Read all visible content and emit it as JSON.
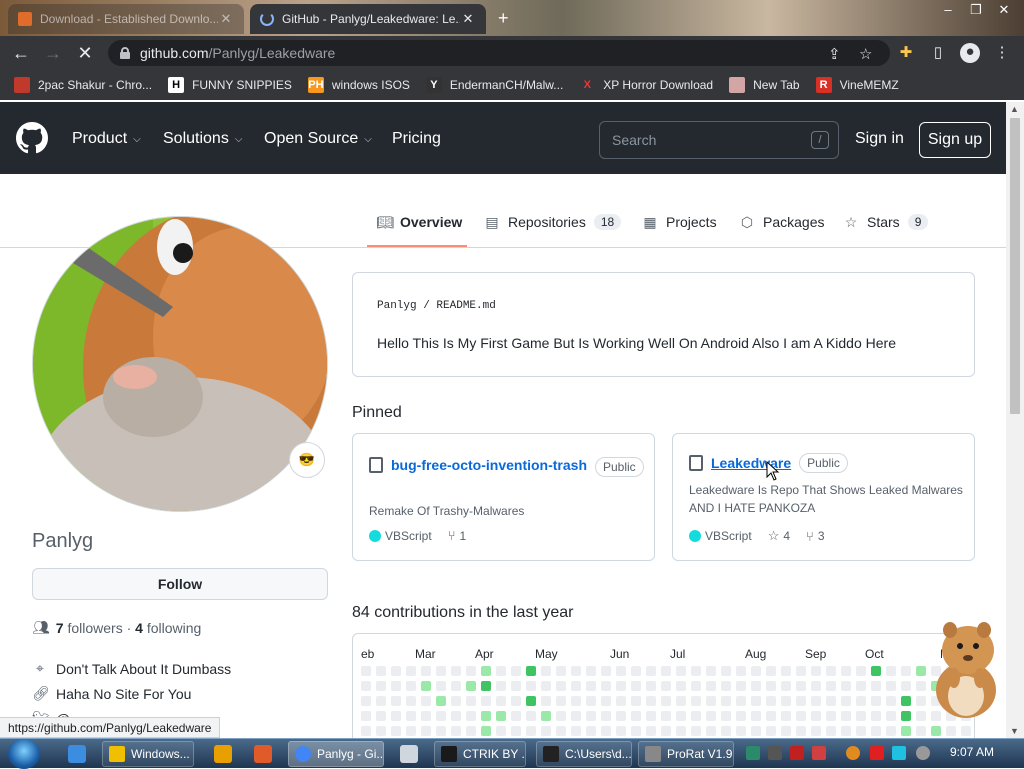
{
  "browser": {
    "tabs": [
      {
        "label": "Download - Established Downlo...",
        "active": false
      },
      {
        "label": "GitHub - Panlyg/Leakedware: Le...",
        "active": true
      }
    ],
    "new_tab": "+",
    "window_controls": {
      "minimize": "–",
      "maximize": "❐",
      "close": "✕"
    },
    "url_host": "github.com",
    "url_path": "/Panlyg/Leakedware",
    "bookmarks": [
      {
        "label": "2pac Shakur - Chro...",
        "icon": "2pac-icon",
        "icon_color": "#c0392b",
        "glyph": ""
      },
      {
        "label": "FUNNY SNIPPIES",
        "icon": "h-icon",
        "icon_color": "#ffffff",
        "glyph": "H"
      },
      {
        "label": "windows ISOS",
        "icon": "ph-icon",
        "icon_color": "#f7971d",
        "glyph": "PH"
      },
      {
        "label": "EndermanCH/Malw...",
        "icon": "yt-icon",
        "icon_color": "#333333",
        "glyph": "Y"
      },
      {
        "label": "XP Horror Download",
        "icon": "x-icon",
        "icon_color": "#35363a",
        "glyph": "X"
      },
      {
        "label": "New Tab",
        "icon": "globe-icon",
        "icon_color": "#d4a5a5",
        "glyph": ""
      },
      {
        "label": "VineMEMZ",
        "icon": "r-icon",
        "icon_color": "#d93025",
        "glyph": "R"
      }
    ]
  },
  "gh_header": {
    "nav": [
      {
        "label": "Product",
        "has_chevron": true
      },
      {
        "label": "Solutions",
        "has_chevron": true
      },
      {
        "label": "Open Source",
        "has_chevron": true
      },
      {
        "label": "Pricing",
        "has_chevron": false
      }
    ],
    "search_placeholder": "Search",
    "search_shortcut": "/",
    "sign_in": "Sign in",
    "sign_up": "Sign up"
  },
  "profile_tabs": [
    {
      "label": "Overview",
      "icon": "book-icon",
      "count": null,
      "selected": true
    },
    {
      "label": "Repositories",
      "icon": "repo-icon",
      "count": "18",
      "selected": false
    },
    {
      "label": "Projects",
      "icon": "table-icon",
      "count": null,
      "selected": false
    },
    {
      "label": "Packages",
      "icon": "package-icon",
      "count": null,
      "selected": false
    },
    {
      "label": "Stars",
      "icon": "star-icon",
      "count": "9",
      "selected": false
    }
  ],
  "profile": {
    "status_emoji": "😎",
    "username": "Panlyg",
    "follow_label": "Follow",
    "followers_count": "7",
    "followers_label": "followers",
    "separator": "·",
    "following_count": "4",
    "following_label": "following",
    "location": "Don't Talk About It Dumbass",
    "website": "Haha No Site For You",
    "twitter": "@..."
  },
  "readme": {
    "path": "Panlyg / README.md",
    "text": "Hello This Is My First Game But Is Working Well On Android Also I am A Kiddo Here"
  },
  "pinned": {
    "title": "Pinned",
    "repos": [
      {
        "name": "bug-free-octo-invention-trash",
        "visibility": "Public",
        "description": "Remake Of Trashy-Malwares",
        "language": "VBScript",
        "language_color": "#15dcdc",
        "stars": null,
        "forks": "1"
      },
      {
        "name": "Leakedware",
        "visibility": "Public",
        "description": "Leakedware Is Repo That Shows Leaked Malwares AND I HATE PANKOZA",
        "language": "VBScript",
        "language_color": "#15dcdc",
        "stars": "4",
        "forks": "3"
      }
    ]
  },
  "contributions": {
    "title": "84 contributions in the last year",
    "months": [
      "eb",
      "Mar",
      "Apr",
      "May",
      "Jun",
      "Jul",
      "Aug",
      "Sep",
      "Oct",
      "N"
    ],
    "colors": {
      "empty": "#ebedf0",
      "l1": "#9be9a8",
      "l2": "#40c463"
    },
    "active_cells": [
      {
        "week": 4,
        "day": 1,
        "level": 1
      },
      {
        "week": 5,
        "day": 2,
        "level": 1
      },
      {
        "week": 7,
        "day": 1,
        "level": 1
      },
      {
        "week": 8,
        "day": 0,
        "level": 1
      },
      {
        "week": 8,
        "day": 1,
        "level": 2
      },
      {
        "week": 8,
        "day": 3,
        "level": 1
      },
      {
        "week": 8,
        "day": 4,
        "level": 1
      },
      {
        "week": 9,
        "day": 3,
        "level": 1
      },
      {
        "week": 11,
        "day": 0,
        "level": 2
      },
      {
        "week": 11,
        "day": 2,
        "level": 2
      },
      {
        "week": 12,
        "day": 3,
        "level": 1
      },
      {
        "week": 34,
        "day": 0,
        "level": 2
      },
      {
        "week": 36,
        "day": 2,
        "level": 2
      },
      {
        "week": 36,
        "day": 3,
        "level": 2
      },
      {
        "week": 36,
        "day": 4,
        "level": 1
      },
      {
        "week": 37,
        "day": 0,
        "level": 1
      },
      {
        "week": 38,
        "day": 1,
        "level": 1
      },
      {
        "week": 38,
        "day": 4,
        "level": 1
      }
    ]
  },
  "status_url": "https://github.com/Panlyg/Leakedware",
  "taskbar": {
    "items": [
      {
        "label": "Windows...",
        "icon_color": "#f0c000",
        "active": false
      },
      {
        "label": "Panlyg - Gi...",
        "icon_color": "#4285f4",
        "active": true
      },
      {
        "label": "CTRIK BY ...",
        "icon_color": "#1a1a1a",
        "active": false
      },
      {
        "label": "C:\\Users\\d...",
        "icon_color": "#222222",
        "active": false
      },
      {
        "label": "ProRat V1.9",
        "icon_color": "#888888",
        "active": false
      }
    ],
    "clock": "9:07 AM"
  }
}
